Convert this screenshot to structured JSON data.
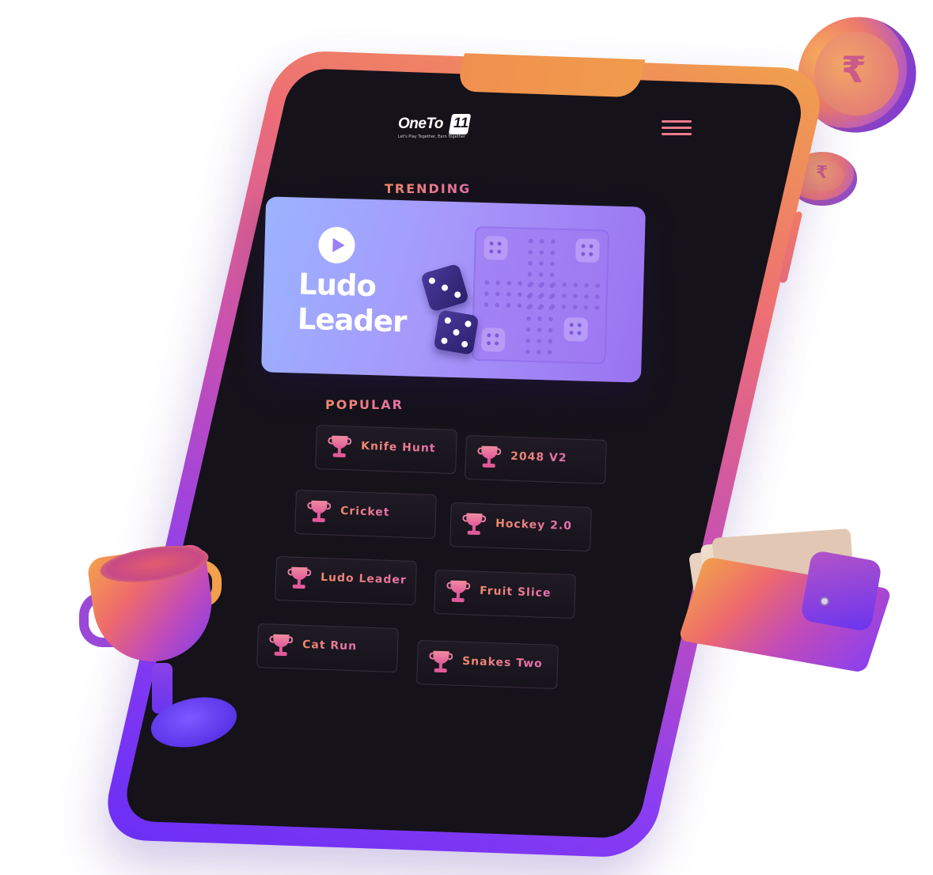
{
  "app": {
    "logo_text": "OneTo",
    "logo_mark": "11",
    "logo_tagline": "Let's Play Together, Earn Together"
  },
  "header": {
    "menu_icon": "hamburger-menu-icon"
  },
  "trending": {
    "section_label": "TRENDING",
    "card": {
      "title_line1": "Ludo",
      "title_line2": "Leader",
      "play_icon": "play-icon"
    }
  },
  "popular": {
    "section_label": "POPULAR",
    "games": [
      {
        "label": "Knife Hunt"
      },
      {
        "label": "2048 V2"
      },
      {
        "label": "Cricket"
      },
      {
        "label": "Hockey 2.0"
      },
      {
        "label": "Ludo Leader"
      },
      {
        "label": "Fruit Slice"
      },
      {
        "label": "Cat Run"
      },
      {
        "label": "Snakes  Two"
      }
    ],
    "item_icon": "trophy-icon"
  },
  "decor": {
    "coin_symbol": "₹",
    "icons": [
      "coin-icon",
      "trophy-icon",
      "wallet-icon"
    ]
  },
  "colors": {
    "screen_bg": "#15121a",
    "accent_orange": "#f08a6a",
    "accent_pink": "#e670b0",
    "accent_purple": "#6a2ef4",
    "card_blue": "#9bb3ff"
  }
}
